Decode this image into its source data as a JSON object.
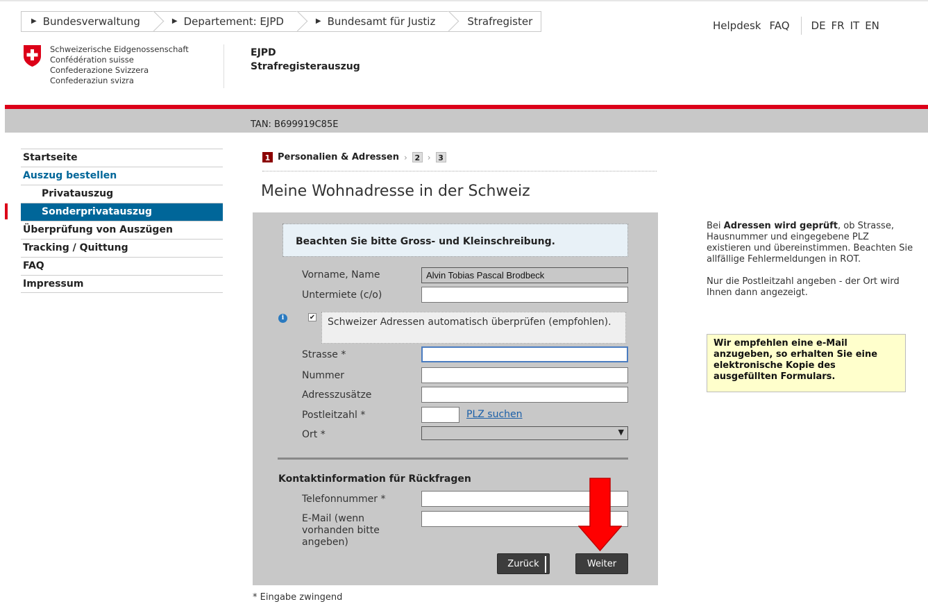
{
  "breadcrumb": [
    {
      "label": "Bundesverwaltung"
    },
    {
      "label": "Departement: EJPD"
    },
    {
      "label": "Bundesamt für Justiz"
    },
    {
      "label": "Strafregister"
    }
  ],
  "topnav": {
    "helpdesk": "Helpdesk",
    "faq": "FAQ",
    "languages": [
      "DE",
      "FR",
      "IT",
      "EN"
    ],
    "active_language": "DE"
  },
  "logo": {
    "lines": [
      "Schweizerische Eidgenossenschaft",
      "Confédération suisse",
      "Confederazione Svizzera",
      "Confederaziun svizra"
    ]
  },
  "header": {
    "dept": "EJPD",
    "app": "Strafregisterauszug"
  },
  "tan": "TAN: B699919C85E",
  "sidebar": {
    "items": [
      {
        "label": "Startseite"
      },
      {
        "label": "Auszug bestellen"
      },
      {
        "label": "Privatauszug"
      },
      {
        "label": "Sonderprivatauszug"
      },
      {
        "label": "Überprüfung von Auszügen"
      },
      {
        "label": "Tracking / Quittung"
      },
      {
        "label": "FAQ"
      },
      {
        "label": "Impressum"
      }
    ]
  },
  "steps": {
    "step1_num": "1",
    "step1_label": "Personalien & Adressen",
    "step2_num": "2",
    "step3_num": "3"
  },
  "page_title": "Meine Wohnadresse in der Schweiz",
  "form": {
    "notice": "Beachten Sie bitte Gross- und Kleinschreibung.",
    "name_label": "Vorname, Name",
    "name_value": "Alvin Tobias Pascal Brodbeck",
    "untermiete_label": "Untermiete (c/o)",
    "info_icon": "i",
    "auto_check_label": "Schweizer Adressen automatisch überprüfen (empfohlen).",
    "auto_check_checked": true,
    "strasse_label": "Strasse *",
    "nummer_label": "Nummer",
    "adresszusaetze_label": "Adresszusätze",
    "plz_label": "Postleitzahl *",
    "plz_link": "PLZ suchen",
    "ort_label": "Ort *",
    "contact_title": "Kontaktinformation für Rückfragen",
    "telefon_label": "Telefonnummer *",
    "email_label": "E-Mail (wenn vorhanden bitte angeben)",
    "back_button": "Zurück",
    "next_button": "Weiter"
  },
  "required_note": "* Eingabe zwingend",
  "right": {
    "p1_pre": "Bei ",
    "p1_bold": "Adressen wird geprüft",
    "p1_post": ", ob Strasse, Hausnummer und eingegebene PLZ existieren und übereinstimmen. Beachten Sie allfällige Fehlermeldungen in ROT.",
    "p2": "Nur die Postleitzahl angeben - der Ort wird Ihnen dann angezeigt.",
    "yellow": "Wir empfehlen eine e-Mail anzugeben, so erhalten Sie eine elektronische Kopie des ausgefüllten Formulars."
  },
  "colors": {
    "swiss_red": "#dc0018",
    "nav_blue": "#006699",
    "panel_grey": "#c8c8c8",
    "arrow_red": "#ff0000"
  },
  "icons": [
    "swiss-cross-icon",
    "info-icon",
    "checkbox-icon",
    "chevron-down-icon",
    "red-down-arrow-icon"
  ]
}
